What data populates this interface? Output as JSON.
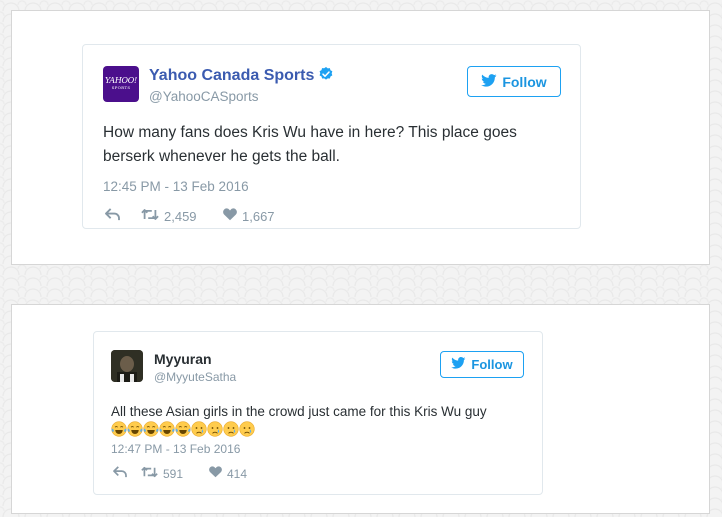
{
  "tweets": [
    {
      "author_name": "Yahoo Canada Sports",
      "handle": "@YahooCASports",
      "avatar_text": "YAHOO!",
      "avatar_subtext": "SPORTS",
      "verified": true,
      "follow_label": "Follow",
      "text": "How many fans does Kris Wu have in here? This place goes berserk whenever he gets the ball.",
      "timestamp": "12:45 PM - 13 Feb 2016",
      "retweets": "2,459",
      "likes": "1,667"
    },
    {
      "author_name": "Myyuran",
      "handle": "@MyyuteSatha",
      "verified": false,
      "follow_label": "Follow",
      "text": "All these Asian girls in the crowd just came for this Kris Wu guy",
      "emojis": [
        "face-with-tears-of-joy",
        "face-with-tears-of-joy",
        "face-with-tears-of-joy",
        "face-with-tears-of-joy",
        "face-with-tears-of-joy",
        "crying-face",
        "crying-face",
        "crying-face",
        "crying-face"
      ],
      "timestamp": "12:47 PM - 13 Feb 2016",
      "retweets": "591",
      "likes": "414"
    }
  ],
  "colors": {
    "twitter_blue": "#1da1f2",
    "yahoo_purple": "#4b0f8c",
    "muted_gray": "#8899a6",
    "text_dark": "#292f33"
  }
}
